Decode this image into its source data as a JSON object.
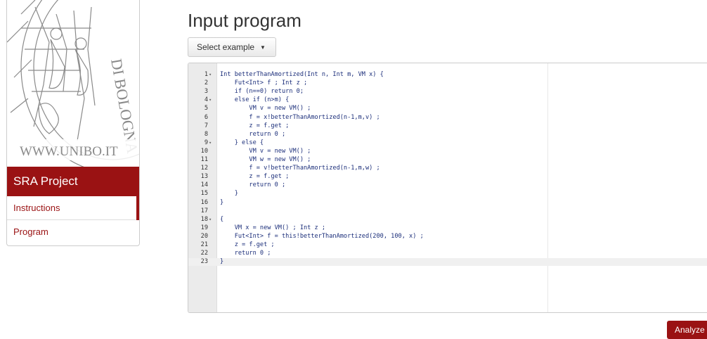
{
  "sidebar": {
    "seal_text": "WWW.UNIBO.IT",
    "seal_letters": "DI BOLOGNA",
    "brand": "SRA Project",
    "nav": [
      {
        "label": "Instructions",
        "active": true
      },
      {
        "label": "Program",
        "active": false
      }
    ]
  },
  "main": {
    "title": "Input program",
    "select_label": "Select example",
    "analyze_label": "Analyze"
  },
  "editor": {
    "active_line": 23,
    "lines": [
      {
        "num": "1",
        "fold": "▾",
        "code": "Int betterThanAmortized(Int n, Int m, VM x) {"
      },
      {
        "num": "2",
        "fold": "",
        "code": "    Fut<Int> f ; Int z ;"
      },
      {
        "num": "3",
        "fold": "",
        "code": "    if (n==0) return 0;"
      },
      {
        "num": "4",
        "fold": "▾",
        "code": "    else if (n>m) {"
      },
      {
        "num": "5",
        "fold": "",
        "code": "        VM v = new VM() ;"
      },
      {
        "num": "6",
        "fold": "",
        "code": "        f = x!betterThanAmortized(n-1,m,v) ;"
      },
      {
        "num": "7",
        "fold": "",
        "code": "        z = f.get ;"
      },
      {
        "num": "8",
        "fold": "",
        "code": "        return 0 ;"
      },
      {
        "num": "9",
        "fold": "▾",
        "code": "    } else {"
      },
      {
        "num": "10",
        "fold": "",
        "code": "        VM v = new VM() ;"
      },
      {
        "num": "11",
        "fold": "",
        "code": "        VM w = new VM() ;"
      },
      {
        "num": "12",
        "fold": "",
        "code": "        f = v!betterThanAmortized(n-1,m,w) ;"
      },
      {
        "num": "13",
        "fold": "",
        "code": "        z = f.get ;"
      },
      {
        "num": "14",
        "fold": "",
        "code": "        return 0 ;"
      },
      {
        "num": "15",
        "fold": "",
        "code": "    }"
      },
      {
        "num": "16",
        "fold": "",
        "code": "}"
      },
      {
        "num": "17",
        "fold": "",
        "code": ""
      },
      {
        "num": "18",
        "fold": "▾",
        "code": "{"
      },
      {
        "num": "19",
        "fold": "",
        "code": "    VM x = new VM() ; Int z ;"
      },
      {
        "num": "20",
        "fold": "",
        "code": "    Fut<Int> f = this!betterThanAmortized(200, 100, x) ;"
      },
      {
        "num": "21",
        "fold": "",
        "code": "    z = f.get ;"
      },
      {
        "num": "22",
        "fold": "",
        "code": "    return 0 ;"
      },
      {
        "num": "23",
        "fold": "",
        "code": "}"
      }
    ]
  }
}
